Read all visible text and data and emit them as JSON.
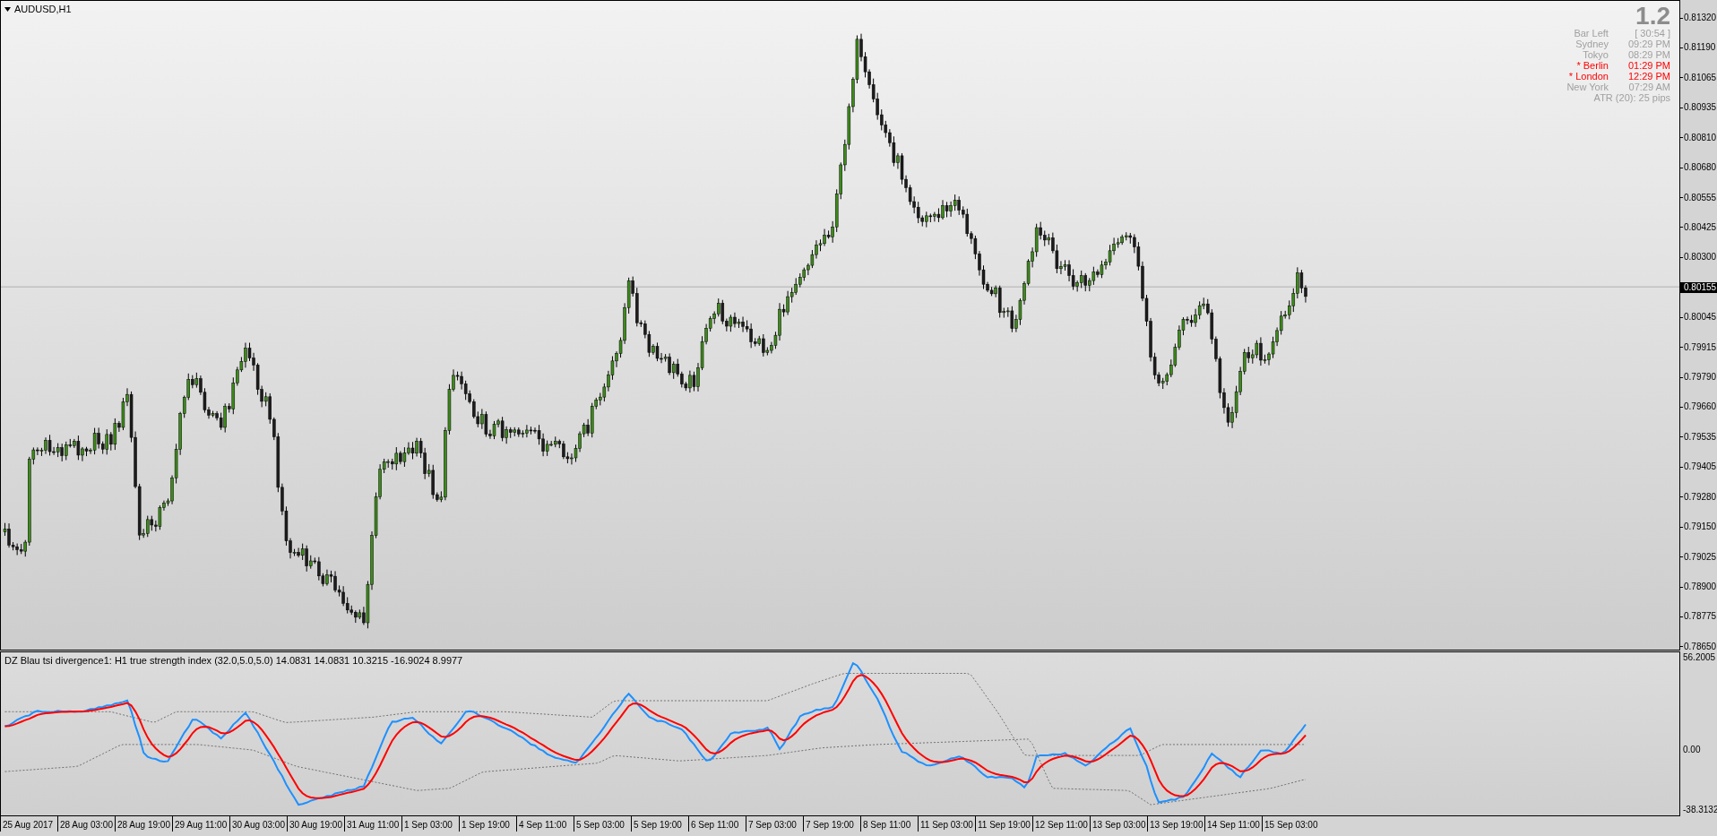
{
  "chart": {
    "title": "AUDUSD,H1",
    "info": {
      "spread": "1.2",
      "rows": [
        {
          "label": "Bar Left",
          "value": "[ 30:54 ]",
          "color": "#a0a0a0"
        },
        {
          "label": "Sydney",
          "value": "09:29 PM",
          "color": "#a0a0a0"
        },
        {
          "label": "Tokyo",
          "value": "08:29 PM",
          "color": "#a0a0a0"
        },
        {
          "label": "* Berlin",
          "value": "01:29 PM",
          "color": "#ff0000"
        },
        {
          "label": "* London",
          "value": "12:29 PM",
          "color": "#ff0000"
        },
        {
          "label": "New York",
          "value": "07:29 AM",
          "color": "#a0a0a0"
        }
      ],
      "atr": "ATR (20): 25 pips"
    },
    "price_axis": [
      {
        "text": "0.81320",
        "kind": "tick"
      },
      {
        "text": "0.81190",
        "kind": "tick"
      },
      {
        "text": "0.81065",
        "kind": "tick"
      },
      {
        "text": "0.80935",
        "kind": "tick"
      },
      {
        "text": "0.80810",
        "kind": "tick"
      },
      {
        "text": "0.80680",
        "kind": "tick"
      },
      {
        "text": "0.80555",
        "kind": "tick"
      },
      {
        "text": "0.80425",
        "kind": "tick"
      },
      {
        "text": "0.80300",
        "kind": "tick"
      },
      {
        "text": "0.80155",
        "kind": "current"
      },
      {
        "text": "0.80045",
        "kind": "tick"
      },
      {
        "text": "0.79915",
        "kind": "tick"
      },
      {
        "text": "0.79790",
        "kind": "tick"
      },
      {
        "text": "0.79660",
        "kind": "tick"
      },
      {
        "text": "0.79535",
        "kind": "tick"
      },
      {
        "text": "0.79405",
        "kind": "tick"
      },
      {
        "text": "0.79280",
        "kind": "tick"
      },
      {
        "text": "0.79150",
        "kind": "tick"
      },
      {
        "text": "0.79025",
        "kind": "tick"
      },
      {
        "text": "0.78900",
        "kind": "tick"
      },
      {
        "text": "0.78775",
        "kind": "tick"
      },
      {
        "text": "0.78650",
        "kind": "tick"
      }
    ]
  },
  "indicator": {
    "label": "DZ Blau tsi divergence1: H1 true strength index (32.0,5.0,5.0) 14.0831 14.0831 10.3215 -16.9024 8.9977",
    "axis": [
      "56.2005",
      "0.00",
      "-38.3132"
    ]
  },
  "time_axis": [
    "25 Aug 2017",
    "28 Aug 03:00",
    "28 Aug 19:00",
    "29 Aug 11:00",
    "30 Aug 03:00",
    "30 Aug 19:00",
    "31 Aug 11:00",
    "1 Sep 03:00",
    "1 Sep 19:00",
    "4 Sep 11:00",
    "5 Sep 03:00",
    "5 Sep 19:00",
    "6 Sep 11:00",
    "7 Sep 03:00",
    "7 Sep 19:00",
    "8 Sep 11:00",
    "11 Sep 03:00",
    "11 Sep 19:00",
    "12 Sep 11:00",
    "13 Sep 03:00",
    "13 Sep 19:00",
    "14 Sep 11:00",
    "15 Sep 03:00"
  ]
}
